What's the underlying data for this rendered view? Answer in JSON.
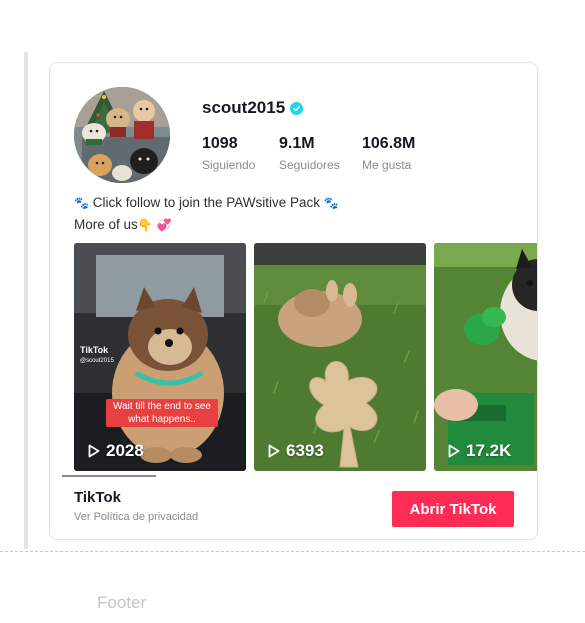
{
  "profile": {
    "username": "scout2015",
    "verified_icon": "verified-check-icon",
    "stats": {
      "following_value": "1098",
      "following_label": "Siguiendo",
      "followers_value": "9.1M",
      "followers_label": "Seguidores",
      "likes_value": "106.8M",
      "likes_label": "Me gusta"
    },
    "bio_line1_text": "Click follow to join the PAWsitive Pack",
    "bio_line2_text": "More of us",
    "bio_icons": [
      "paw-prints-icon",
      "paw-prints-icon",
      "pointing-down-hand-icon",
      "sparkling-heart-icon"
    ]
  },
  "videos": [
    {
      "views": "2028",
      "watermark_brand": "TikTok",
      "watermark_handle": "@scout2015",
      "caption": "Wait till the end to see what happens.."
    },
    {
      "views": "6393"
    },
    {
      "views": "17.2K"
    }
  ],
  "footer": {
    "brand": "TikTok",
    "privacy_link": "Ver Política de privacidad",
    "open_button": "Abrir TikTok"
  },
  "page_footer_label": "Footer",
  "colors": {
    "accent": "#fe2c55",
    "verified": "#20d5ec",
    "text_primary": "#161823",
    "text_secondary": "#8a8b91"
  }
}
